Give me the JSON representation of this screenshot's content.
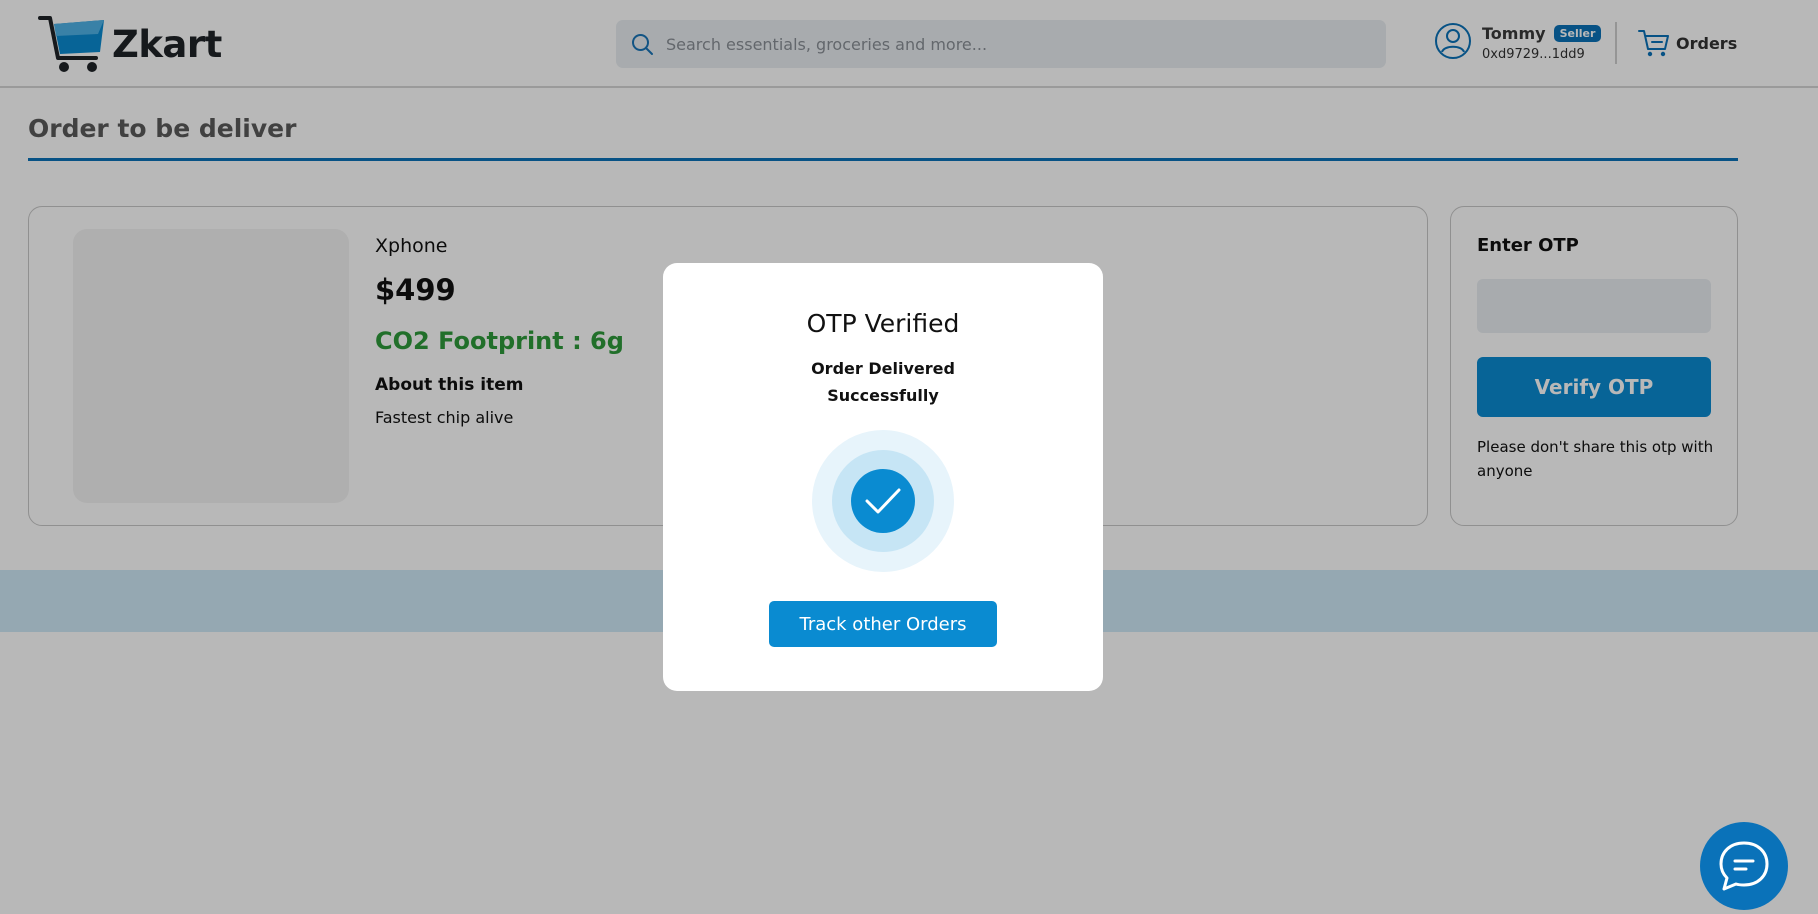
{
  "brand": {
    "name": "Zkart"
  },
  "search": {
    "placeholder": "Search essentials, groceries and more..."
  },
  "user": {
    "name": "Tommy",
    "badge": "Seller",
    "address": "0xd9729...1dd9"
  },
  "nav": {
    "orders_label": "Orders"
  },
  "page": {
    "title": "Order to be deliver"
  },
  "product": {
    "name": "Xphone",
    "price": "$499",
    "co2": "CO2 Footprint : 6g",
    "about_label": "About this item",
    "about_text": "Fastest chip alive"
  },
  "otp": {
    "title": "Enter OTP",
    "input_value": "",
    "verify_label": "Verify OTP",
    "note": "Please don't share this otp with anyone"
  },
  "modal": {
    "title": "OTP Verified",
    "subtitle": "Order Delivered Successfully",
    "button_label": "Track other Orders"
  },
  "colors": {
    "accent": "#0a8bd1",
    "brand_dark": "#0a72b9",
    "co2_green": "#2e9a3b"
  },
  "icons": {
    "logo": "cart-logo-icon",
    "search": "search-icon",
    "user": "user-circle-icon",
    "orders": "cart-icon",
    "success": "check-icon",
    "chat": "chat-icon"
  }
}
